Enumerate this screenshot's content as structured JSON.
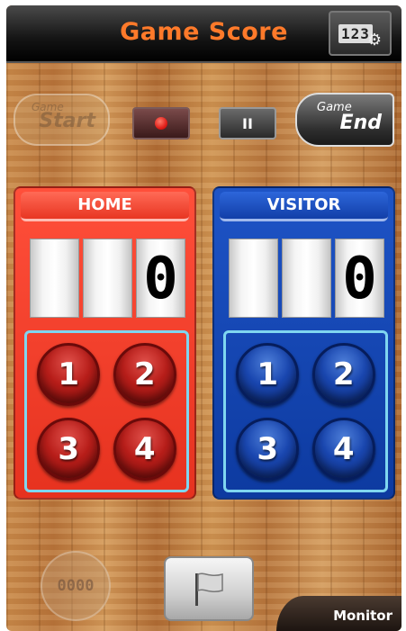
{
  "header": {
    "title": "Game Score",
    "settings_digits": "123",
    "settings_icon": "gear-icon"
  },
  "controls": {
    "game_start_small": "Game",
    "game_start_big": "Start",
    "record_icon": "record-icon",
    "pause_label": "II",
    "game_end_small": "Game",
    "game_end_big": "End"
  },
  "home": {
    "name": "HOME",
    "score_digits": [
      "",
      "",
      "0"
    ],
    "buttons": [
      "1",
      "2",
      "3",
      "4"
    ],
    "color": "#f0402c"
  },
  "visitor": {
    "name": "VISITOR",
    "score_digits": [
      "",
      "",
      "0"
    ],
    "buttons": [
      "1",
      "2",
      "3",
      "4"
    ],
    "color": "#1747b5"
  },
  "footer": {
    "dial_label": "0000",
    "flag_icon": "flag-icon",
    "monitor_label": "Monitor"
  }
}
